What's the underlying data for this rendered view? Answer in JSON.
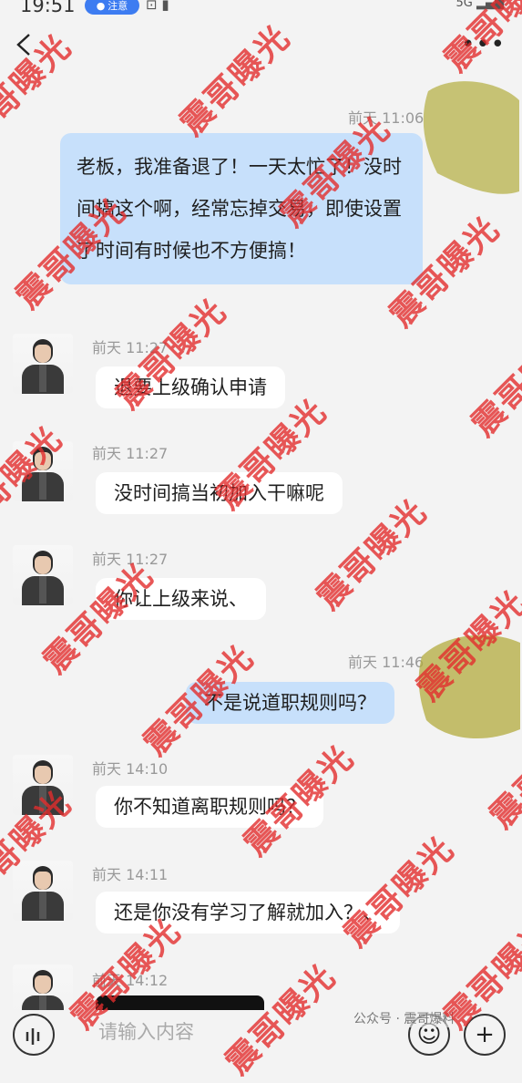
{
  "status_bar": {
    "time": "19:51",
    "notice": "注意",
    "signal": "5G"
  },
  "nav": {
    "back_icon": "chevron-left-icon",
    "more_label": "•••"
  },
  "messages": [
    {
      "side": "out",
      "time": "前天 11:06",
      "text": "老板，我准备退了！一天太忙了！没时间搞这个啊，经常忘掉交易，即使设置了时间有时候也不方便搞！"
    },
    {
      "side": "in",
      "time": "前天 11:27",
      "text": "退要上级确认申请"
    },
    {
      "side": "in",
      "time": "前天 11:27",
      "text": "没时间搞当初加入干嘛呢"
    },
    {
      "side": "in",
      "time": "前天 11:27",
      "text": "你让上级来说、"
    },
    {
      "side": "out",
      "time": "前天 11:46",
      "text": "不是说道职规则吗？"
    },
    {
      "side": "in",
      "time": "前天 14:10",
      "text": "你不知道离职规则吗？"
    },
    {
      "side": "in",
      "time": "前天 14:11",
      "text": "还是你没有学习了解就加入？、"
    },
    {
      "side": "in",
      "time": "前天 14:12",
      "text": ""
    }
  ],
  "input": {
    "placeholder": "请输入内容",
    "source_tag": "公众号 · 震哥爆料"
  },
  "watermark": "震哥曝光",
  "colors": {
    "out_bubble": "#c7e0fb",
    "in_bubble": "#ffffff",
    "watermark": "#e22d2d",
    "notice": "#3d7cf1"
  }
}
